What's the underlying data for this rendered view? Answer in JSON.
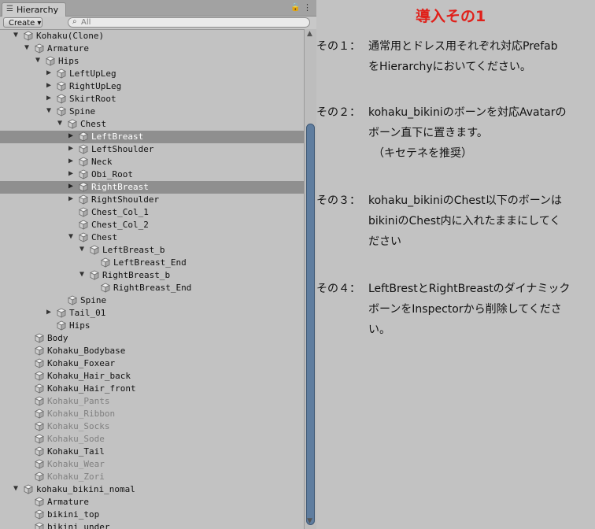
{
  "hierarchy": {
    "tab_label": "Hierarchy",
    "tab_icon": "list-icon",
    "create_label": "Create ▾",
    "search_placeholder": "All",
    "rows": [
      {
        "label": "Kohaku(Clone)",
        "arrow": "▼"
      },
      {
        "label": "Armature",
        "arrow": "▼"
      },
      {
        "label": "Hips",
        "arrow": "▼"
      },
      {
        "label": "LeftUpLeg",
        "arrow": "▶"
      },
      {
        "label": "RightUpLeg",
        "arrow": "▶"
      },
      {
        "label": "SkirtRoot",
        "arrow": "▶"
      },
      {
        "label": "Spine",
        "arrow": "▼"
      },
      {
        "label": "Chest",
        "arrow": "▼"
      },
      {
        "label": "LeftBreast",
        "arrow": "▶",
        "selected": true
      },
      {
        "label": "LeftShoulder",
        "arrow": "▶"
      },
      {
        "label": "Neck",
        "arrow": "▶"
      },
      {
        "label": "Obi_Root",
        "arrow": "▶"
      },
      {
        "label": "RightBreast",
        "arrow": "▶",
        "selected": true
      },
      {
        "label": "RightShoulder",
        "arrow": "▶"
      },
      {
        "label": "Chest_Col_1",
        "arrow": ""
      },
      {
        "label": "Chest_Col_2",
        "arrow": ""
      },
      {
        "label": "Chest",
        "arrow": "▼"
      },
      {
        "label": "LeftBreast_b",
        "arrow": "▼"
      },
      {
        "label": "LeftBreast_End",
        "arrow": ""
      },
      {
        "label": "RightBreast_b",
        "arrow": "▼"
      },
      {
        "label": "RightBreast_End",
        "arrow": ""
      },
      {
        "label": "Spine",
        "arrow": ""
      },
      {
        "label": "Tail_01",
        "arrow": "▶"
      },
      {
        "label": "Hips",
        "arrow": ""
      },
      {
        "label": "Body",
        "arrow": ""
      },
      {
        "label": "Kohaku_Bodybase",
        "arrow": ""
      },
      {
        "label": "Kohaku_Foxear",
        "arrow": ""
      },
      {
        "label": "Kohaku_Hair_back",
        "arrow": ""
      },
      {
        "label": "Kohaku_Hair_front",
        "arrow": ""
      },
      {
        "label": "Kohaku_Pants",
        "arrow": "",
        "inactive": true
      },
      {
        "label": "Kohaku_Ribbon",
        "arrow": "",
        "inactive": true
      },
      {
        "label": "Kohaku_Socks",
        "arrow": "",
        "inactive": true
      },
      {
        "label": "Kohaku_Sode",
        "arrow": "",
        "inactive": true
      },
      {
        "label": "Kohaku_Tail",
        "arrow": ""
      },
      {
        "label": "Kohaku_Wear",
        "arrow": "",
        "inactive": true
      },
      {
        "label": "Kohaku_Zori",
        "arrow": "",
        "inactive": true
      },
      {
        "label": "kohaku_bikini_nomal",
        "arrow": "▼"
      },
      {
        "label": "Armature",
        "arrow": ""
      },
      {
        "label": "bikini_top",
        "arrow": ""
      },
      {
        "label": "bikini_under",
        "arrow": ""
      }
    ]
  },
  "instructions": {
    "title": "導入その1",
    "steps": [
      {
        "num": "その１：",
        "lines": [
          "通常用とドレス用それぞれ対応Prefab",
          "をHierarchyにおいてください。"
        ]
      },
      {
        "num": "その２：",
        "lines": [
          "kohaku_bikiniのボーンを対応Avatarの",
          "ボーン直下に置きます。",
          "（キセテネを推奨）"
        ]
      },
      {
        "num": "その３：",
        "lines": [
          "kohaku_bikiniのChest以下のボーンは",
          "bikiniのChest内に入れたままにしてく",
          "ださい"
        ]
      },
      {
        "num": "その４：",
        "lines": [
          "LeftBrestとRightBreastのダイナミック",
          "ボーンをInspectorから削除してくださ",
          "い。"
        ]
      }
    ]
  },
  "colors": {
    "panel_bg": "#c2c2c2",
    "selection": "#8f8f8f",
    "scroll_thumb": "#5f7d9f",
    "title_red": "#e0201a",
    "inactive_text": "#808080"
  }
}
